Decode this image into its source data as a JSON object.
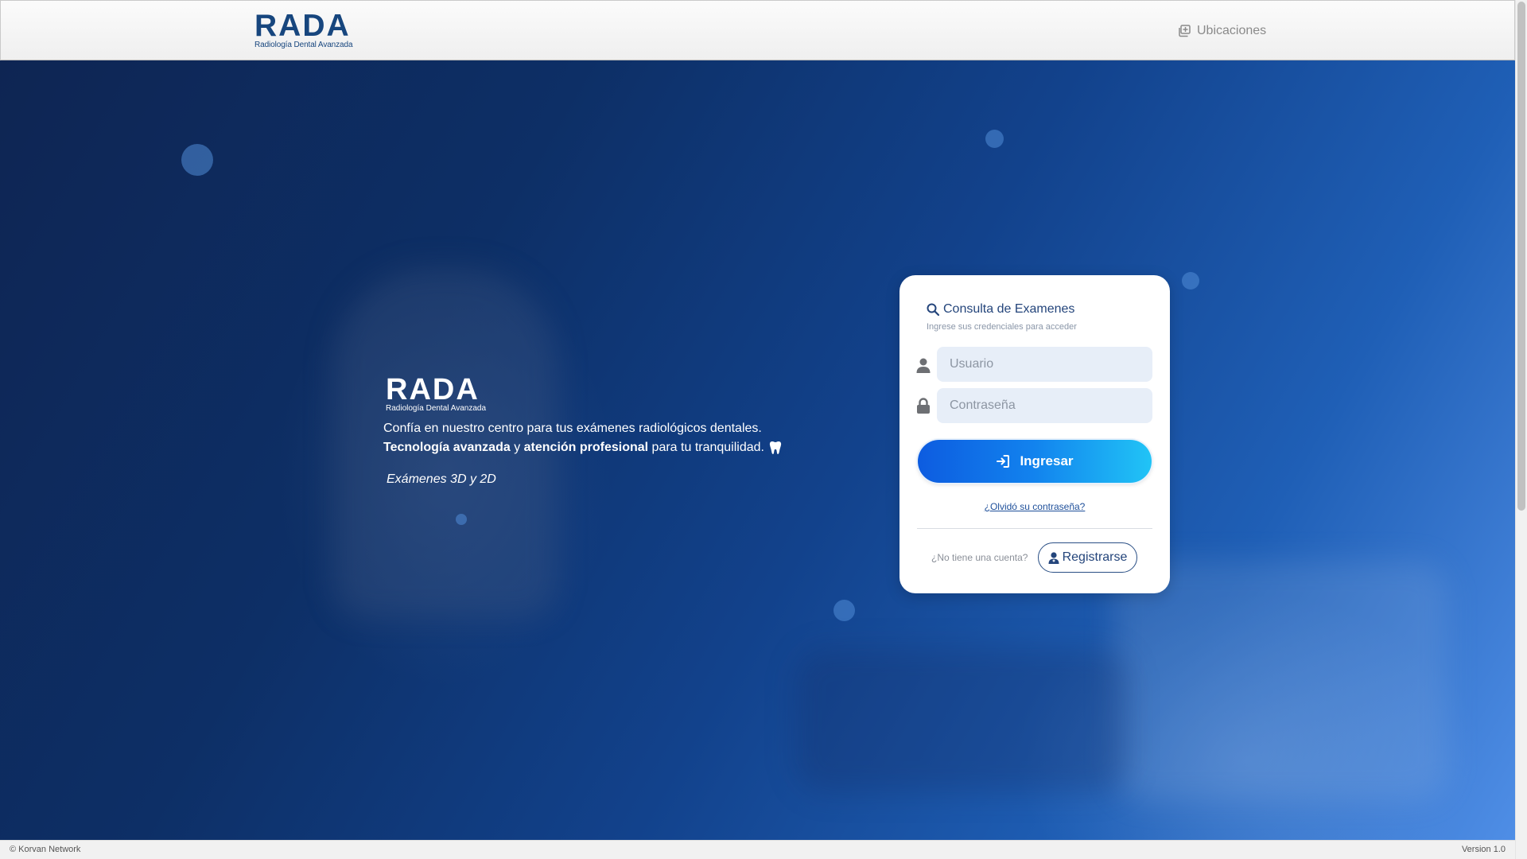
{
  "header": {
    "logo_word": "RADA",
    "logo_sub": "Radiología Dental Avanzada",
    "locations_label": "Ubicaciones",
    "locations_icon": "locations-icon"
  },
  "hero": {
    "logo_word": "RADA",
    "logo_sub": "Radiología Dental Avanzada",
    "line1": "Confía en nuestro centro para tus exámenes radiológicos dentales.",
    "line2_bold1": "Tecnología avanzada",
    "line2_conj": " y ",
    "line2_bold2": "atención profesional",
    "line2_rest": " para tu tranquilidad.",
    "line2_icon": "tooth-icon",
    "exams": "Exámenes 3D y 2D"
  },
  "login": {
    "title": "Consulta de Examenes",
    "title_icon": "search-icon",
    "subtitle": "Ingrese sus credenciales para acceder",
    "username_placeholder": "Usuario",
    "username_value": "",
    "password_placeholder": "Contraseña",
    "password_value": "",
    "submit_label": "Ingresar",
    "submit_icon": "sign-in-icon",
    "forgot_label": "¿Olvidó su contraseña?",
    "no_account_label": "¿No tiene una cuenta?",
    "register_label": "Registrarse",
    "register_icon": "user-doctor-icon"
  },
  "footer": {
    "copyright": "© Korvan Network",
    "version": "Version 1.0"
  },
  "colors": {
    "brand_navy": "#17467e",
    "hero_dark": "#0e2553",
    "hero_light": "#4f8ee6",
    "button_start": "#0d5ce0",
    "button_end": "#21c4f6",
    "input_bg": "#e7eef8"
  }
}
